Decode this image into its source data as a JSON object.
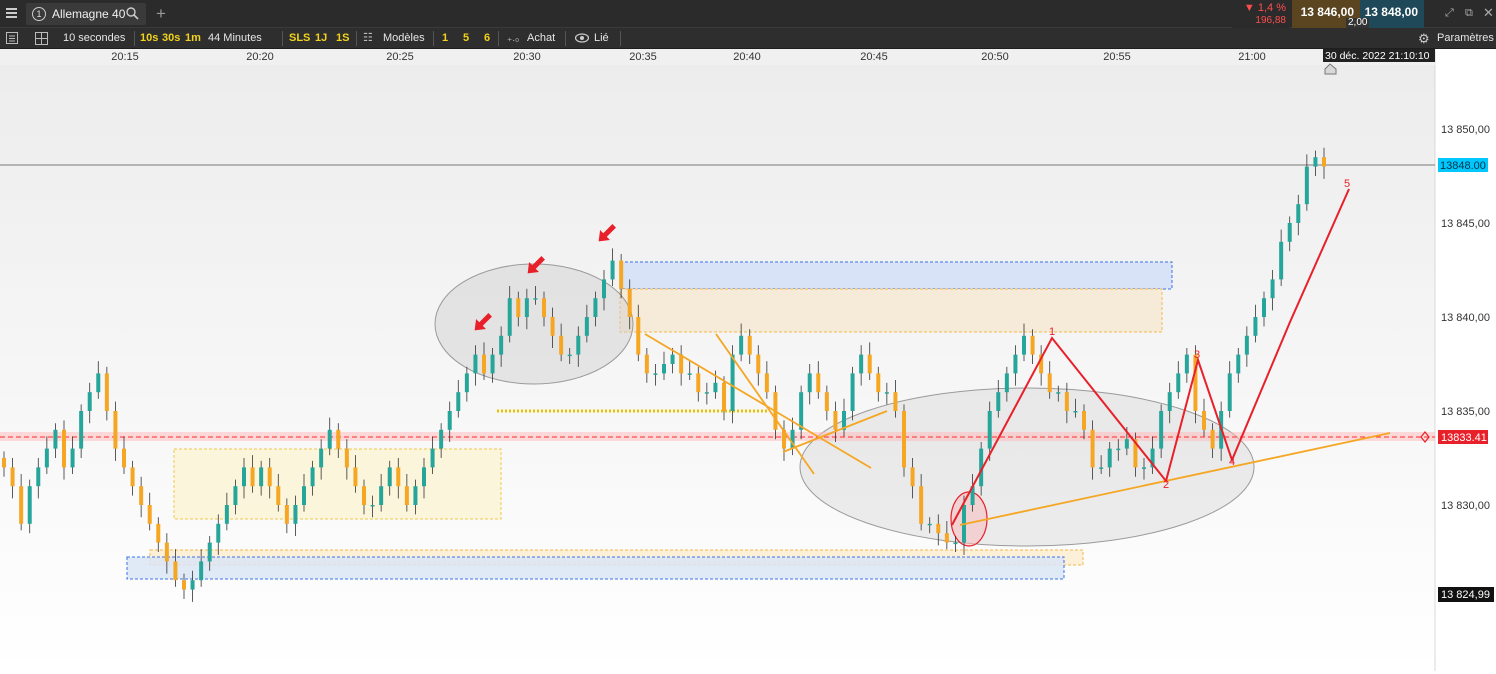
{
  "topbar": {
    "menu_icon": "hamburger-menu-icon",
    "instrument_number": "1",
    "instrument_name": "Allemagne 40",
    "change_pct": "▼ 1,4 %",
    "change_abs": "196,88",
    "bid": "13 846,00",
    "ask": "13 848,00",
    "spread": "2,00"
  },
  "toolbar": {
    "interval": "10 secondes",
    "tf_10s": "10s",
    "tf_30s": "30s",
    "tf_1m": "1m",
    "duration": "44 Minutes",
    "sls": "SLS",
    "one_j": "1J",
    "one_s": "1S",
    "models": "Modèles",
    "n1": "1",
    "n5": "5",
    "n6": "6",
    "buy": "Achat",
    "linked": "Lié",
    "settings": "Paramètres"
  },
  "colors": {
    "bull": "#26a69a",
    "bear": "#f5a623",
    "accent_red": "#e8202a",
    "orange_line": "#f5a623",
    "current_price_label": "#00c8ff"
  },
  "chart_data": {
    "type": "candlestick",
    "instrument": "Allemagne 40",
    "timeframe": "10 secondes",
    "x_ticks": [
      "20:15",
      "20:20",
      "20:25",
      "20:30",
      "20:35",
      "20:40",
      "20:45",
      "20:50",
      "20:55",
      "21:00"
    ],
    "cursor_time": "30 déc. 2022 21:10:10",
    "y_ticks": [
      "13 850,00",
      "13 845,00",
      "13 840,00",
      "13 835,00",
      "13 830,00"
    ],
    "ylim": [
      13821.5,
      13857.5
    ],
    "current_price_label": "13848.00",
    "red_line_label": "13833.41",
    "low_label": "13 824,99",
    "wave_labels": [
      "1",
      "2",
      "3",
      "4",
      "5"
    ],
    "closes": [
      13832,
      13831,
      13829,
      13831,
      13832,
      13833,
      13834,
      13832,
      13833,
      13835,
      13836,
      13837,
      13835,
      13833,
      13832,
      13831,
      13830,
      13829,
      13828,
      13827,
      13826,
      13825.5,
      13826,
      13827,
      13828,
      13829,
      13830,
      13831,
      13832,
      13831,
      13832,
      13831,
      13830,
      13829,
      13830,
      13831,
      13832,
      13833,
      13834,
      13833,
      13832,
      13831,
      13830,
      13830,
      13831,
      13832,
      13831,
      13830,
      13831,
      13832,
      13833,
      13834,
      13835,
      13836,
      13837,
      13838,
      13837,
      13838,
      13839,
      13841,
      13840,
      13841,
      13841,
      13840,
      13839,
      13838,
      13838,
      13839,
      13840,
      13841,
      13842,
      13843,
      13841.5,
      13840,
      13838,
      13837,
      13837,
      13837.5,
      13838,
      13837,
      13837,
      13836,
      13836,
      13836.5,
      13835,
      13838,
      13839,
      13838,
      13837,
      13836,
      13834,
      13833,
      13834,
      13836,
      13837,
      13836,
      13835,
      13834,
      13835,
      13837,
      13838,
      13837,
      13836,
      13836,
      13835,
      13832,
      13831,
      13829,
      13829,
      13828.5,
      13828,
      13828,
      13830,
      13831,
      13833,
      13835,
      13836,
      13837,
      13838,
      13839,
      13838,
      13837,
      13836,
      13836,
      13835,
      13835,
      13834,
      13832,
      13832,
      13833,
      13833,
      13833.5,
      13832,
      13832,
      13833,
      13835,
      13836,
      13837,
      13838,
      13835,
      13834,
      13833,
      13835,
      13837,
      13838,
      13839,
      13840,
      13841,
      13842,
      13844,
      13845,
      13846,
      13848,
      13848.5,
      13848
    ]
  }
}
